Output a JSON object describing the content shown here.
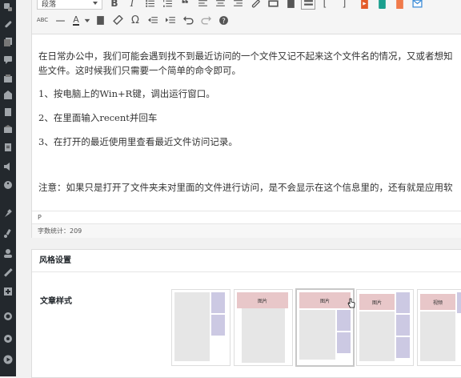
{
  "sidebar": {
    "icons": [
      "settings-icon",
      "link-icon",
      "pages-icon",
      "comments-icon",
      "store-icon",
      "shop-icon",
      "document-icon",
      "media-icon",
      "accessibility-icon",
      "pin-icon",
      "brush-icon",
      "user-icon",
      "wrench-icon",
      "plus-icon",
      "collapse-icon",
      "gear-icon",
      "play-icon"
    ]
  },
  "toolbar": {
    "format_select": "段落",
    "row1_buttons": [
      "bold",
      "italic",
      "bullet-list",
      "number-list",
      "blockquote",
      "align-left",
      "align-center",
      "align-right",
      "link",
      "unlink",
      "read-more",
      "toolbar-toggle",
      "bracket-left",
      "bracket-right",
      "media",
      "plugin",
      "code",
      "mail"
    ],
    "row2_buttons": [
      "strikethrough",
      "horizontal-rule",
      "text-color",
      "paste-as-text",
      "clear-formatting",
      "special-character",
      "outdent",
      "indent",
      "undo",
      "redo",
      "help"
    ]
  },
  "content": {
    "paragraphs": [
      "在日常办公中，我们可能会遇到找不到最近访问的一个文件又记不起来这个文件名的情况，又或者想知",
      "些文件。这时候我们只需要一个简单的命令即可。",
      "1、按电脑上的Win+R键，调出运行窗口。",
      "2、在里面输入recent并回车",
      "3、在打开的最近使用里查看最近文件访问记录。",
      "注意：如果只是打开了文件夹未对里面的文件进行访问，是不会显示在这个信息里的，还有就是应用软"
    ],
    "path": "P",
    "word_count": "字数统计：209"
  },
  "style_panel": {
    "title": "风格设置",
    "article_style_label": "文章样式",
    "thumb_labels": [
      "",
      "图片",
      "图片",
      "图片",
      "视频"
    ],
    "selected_index": 2
  },
  "colors": {
    "sidebar_bg": "#23282d",
    "thumb_gray": "#e6e6e6",
    "thumb_violet": "#ccc9e3",
    "thumb_pink": "#e8c7c9"
  }
}
